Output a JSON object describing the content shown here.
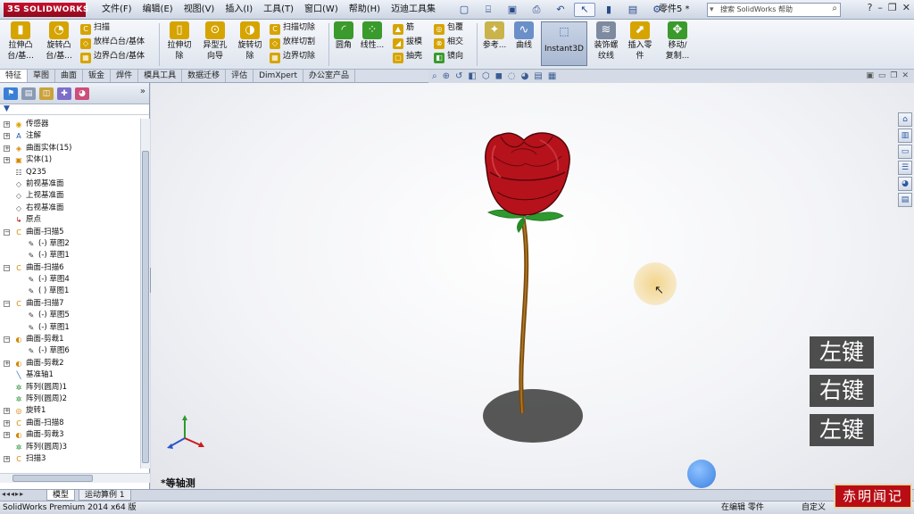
{
  "app": {
    "logo_text": "SOLIDWORKS",
    "logo_mark": "3S"
  },
  "menu": [
    "文件(F)",
    "编辑(E)",
    "视图(V)",
    "插入(I)",
    "工具(T)",
    "窗口(W)",
    "帮助(H)",
    "迈迪工具集"
  ],
  "title": {
    "part_name": "零件5 *"
  },
  "search": {
    "placeholder": "搜索 SolidWorks 帮助"
  },
  "ribbon": {
    "extrude_boss": "拉伸凸\n台/基...",
    "revolve_boss": "旋转凸\n台/基...",
    "sweep": "扫描",
    "loft_boss": "放样凸台/基体",
    "boundary_boss": "边界凸台/基体",
    "extrude_cut": "拉伸切\n除",
    "hole_wizard": "异型孔\n向导",
    "revolve_cut": "旋转切\n除",
    "sweep_cut": "扫描切除",
    "loft_cut": "放样切割",
    "boundary_cut": "边界切除",
    "fillet": "圆角",
    "linear_pattern": "线性...",
    "rib": "筋",
    "draft": "拔模",
    "shell": "抽壳",
    "wrap": "包覆",
    "intersect": "相交",
    "mirror": "镜向",
    "reference": "参考...",
    "curves": "曲线",
    "instant3d": "Instant3D",
    "cosmetic_thread": "装饰螺\n纹线",
    "insert_part": "插入零\n件",
    "move_copy": "移动/\n复制..."
  },
  "command_tabs": [
    "特征",
    "草图",
    "曲面",
    "钣金",
    "焊件",
    "模具工具",
    "数据迁移",
    "评估",
    "DimXpert",
    "办公室产品"
  ],
  "tree": [
    {
      "label": "传感器",
      "indent": 0,
      "expand": "+",
      "icon": "sensor-icon",
      "glyph": "◉",
      "color": "#d9a400"
    },
    {
      "label": "注解",
      "indent": 0,
      "expand": "+",
      "icon": "annotation-icon",
      "glyph": "A",
      "color": "#1d56b0"
    },
    {
      "label": "曲面实体(15)",
      "indent": 0,
      "expand": "+",
      "icon": "surface-body-icon",
      "glyph": "◈",
      "color": "#d38600"
    },
    {
      "label": "实体(1)",
      "indent": 0,
      "expand": "+",
      "icon": "solid-body-icon",
      "glyph": "▣",
      "color": "#d38600"
    },
    {
      "label": "Q235",
      "indent": 0,
      "expand": "",
      "icon": "material-icon",
      "glyph": "☷",
      "color": "#444"
    },
    {
      "label": "前视基准面",
      "indent": 0,
      "expand": "",
      "icon": "plane-icon",
      "glyph": "◇",
      "color": "#555"
    },
    {
      "label": "上视基准面",
      "indent": 0,
      "expand": "",
      "icon": "plane-icon",
      "glyph": "◇",
      "color": "#555"
    },
    {
      "label": "右视基准面",
      "indent": 0,
      "expand": "",
      "icon": "plane-icon",
      "glyph": "◇",
      "color": "#555"
    },
    {
      "label": "原点",
      "indent": 0,
      "expand": "",
      "icon": "origin-icon",
      "glyph": "↳",
      "color": "#b00"
    },
    {
      "label": "曲面-扫描5",
      "indent": 0,
      "expand": "−",
      "icon": "surface-sweep-icon",
      "glyph": "C",
      "color": "#d38600"
    },
    {
      "label": "(-) 草图2",
      "indent": 1,
      "expand": "",
      "icon": "sketch-icon",
      "glyph": "✎",
      "color": "#333"
    },
    {
      "label": "(-) 草图1",
      "indent": 1,
      "expand": "",
      "icon": "sketch-icon",
      "glyph": "✎",
      "color": "#333"
    },
    {
      "label": "曲面-扫描6",
      "indent": 0,
      "expand": "−",
      "icon": "surface-sweep-icon",
      "glyph": "C",
      "color": "#d38600"
    },
    {
      "label": "(-) 草图4",
      "indent": 1,
      "expand": "",
      "icon": "sketch-icon",
      "glyph": "✎",
      "color": "#333"
    },
    {
      "label": "( ) 草图1",
      "indent": 1,
      "expand": "",
      "icon": "sketch-icon",
      "glyph": "✎",
      "color": "#333"
    },
    {
      "label": "曲面-扫描7",
      "indent": 0,
      "expand": "−",
      "icon": "surface-sweep-icon",
      "glyph": "C",
      "color": "#d38600"
    },
    {
      "label": "(-) 草图5",
      "indent": 1,
      "expand": "",
      "icon": "sketch-icon",
      "glyph": "✎",
      "color": "#333"
    },
    {
      "label": "(-) 草图1",
      "indent": 1,
      "expand": "",
      "icon": "sketch-icon",
      "glyph": "✎",
      "color": "#333"
    },
    {
      "label": "曲面-剪裁1",
      "indent": 0,
      "expand": "−",
      "icon": "surface-trim-icon",
      "glyph": "◐",
      "color": "#d38600"
    },
    {
      "label": "(-) 草图6",
      "indent": 1,
      "expand": "",
      "icon": "sketch-icon",
      "glyph": "✎",
      "color": "#333"
    },
    {
      "label": "曲面-剪裁2",
      "indent": 0,
      "expand": "+",
      "icon": "surface-trim-icon",
      "glyph": "◐",
      "color": "#d38600"
    },
    {
      "label": "基准轴1",
      "indent": 0,
      "expand": "",
      "icon": "axis-icon",
      "glyph": "╲",
      "color": "#1f5fbf"
    },
    {
      "label": "阵列(圆周)1",
      "indent": 0,
      "expand": "",
      "icon": "circular-pattern-icon",
      "glyph": "✲",
      "color": "#1d8a2f"
    },
    {
      "label": "阵列(圆周)2",
      "indent": 0,
      "expand": "",
      "icon": "circular-pattern-icon",
      "glyph": "✲",
      "color": "#1d8a2f"
    },
    {
      "label": "旋转1",
      "indent": 0,
      "expand": "+",
      "icon": "revolve-icon",
      "glyph": "◎",
      "color": "#d38600"
    },
    {
      "label": "曲面-扫描8",
      "indent": 0,
      "expand": "+",
      "icon": "surface-sweep-icon",
      "glyph": "C",
      "color": "#d38600"
    },
    {
      "label": "曲面-剪裁3",
      "indent": 0,
      "expand": "+",
      "icon": "surface-trim-icon",
      "glyph": "◐",
      "color": "#d38600"
    },
    {
      "label": "阵列(圆周)3",
      "indent": 0,
      "expand": "",
      "icon": "circular-pattern-icon",
      "glyph": "✲",
      "color": "#1d8a2f"
    },
    {
      "label": "扫描3",
      "indent": 0,
      "expand": "+",
      "icon": "sweep-icon",
      "glyph": "C",
      "color": "#d38600"
    }
  ],
  "viewport": {
    "view_label": "*等轴测",
    "key_hints": [
      "左键",
      "右键",
      "左键"
    ]
  },
  "bottom_tabs": [
    "模型",
    "运动算例 1"
  ],
  "status": {
    "version": "SolidWorks Premium 2014 x64 版",
    "editing": "在编辑 零件",
    "custom": "自定义"
  },
  "watermark": "赤明闻记",
  "colors": {
    "accent": "#c8102e",
    "petal": "#b5121b",
    "leaf": "#2e9a2e",
    "stem": "#8a5a12"
  }
}
